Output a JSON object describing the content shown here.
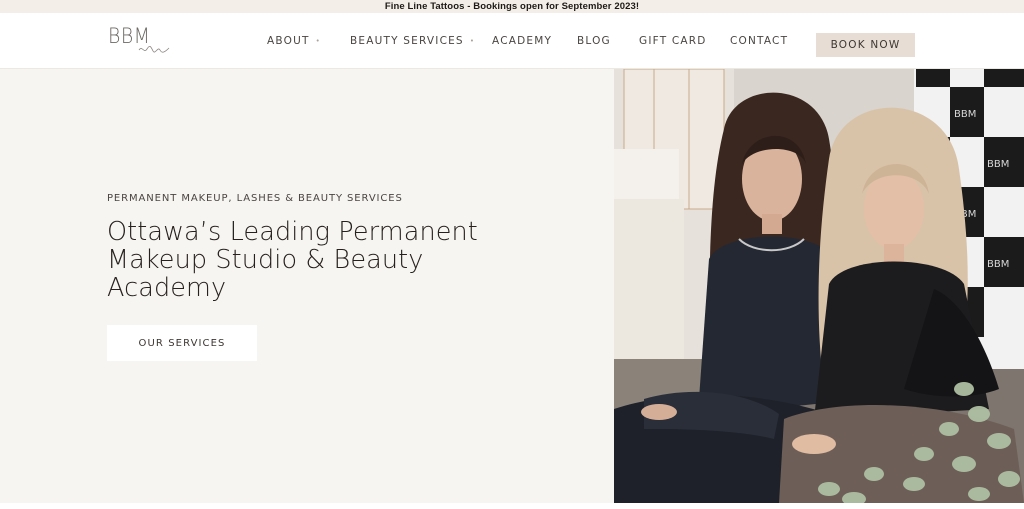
{
  "announcement": {
    "text": "Fine Line Tattoos - Bookings open for September 2023!"
  },
  "header": {
    "logo_text": "BBM",
    "nav": [
      {
        "label": "ABOUT",
        "has_dropdown": true
      },
      {
        "label": "BEAUTY SERVICES",
        "has_dropdown": true
      },
      {
        "label": "ACADEMY",
        "has_dropdown": false
      },
      {
        "label": "BLOG",
        "has_dropdown": false
      },
      {
        "label": "GIFT CARD",
        "has_dropdown": false
      },
      {
        "label": "CONTACT",
        "has_dropdown": false
      }
    ],
    "dropdown_icon": "•",
    "cta_label": "BOOK NOW"
  },
  "hero": {
    "eyebrow": "PERMANENT MAKEUP, LASHES & BEAUTY SERVICES",
    "headline_lines": [
      "Ottawa’s Leading Permanent",
      "Makeup Studio & Beauty",
      "Academy"
    ],
    "cta_label": "OUR SERVICES",
    "photo": {
      "icon": "photo",
      "backdrop_text": "BBM"
    }
  },
  "colors": {
    "announcement_bg": "#f3efe8",
    "hero_bg": "#f7f5f1",
    "book_button_bg": "#e7ddd4",
    "text_dark": "#26211e"
  }
}
